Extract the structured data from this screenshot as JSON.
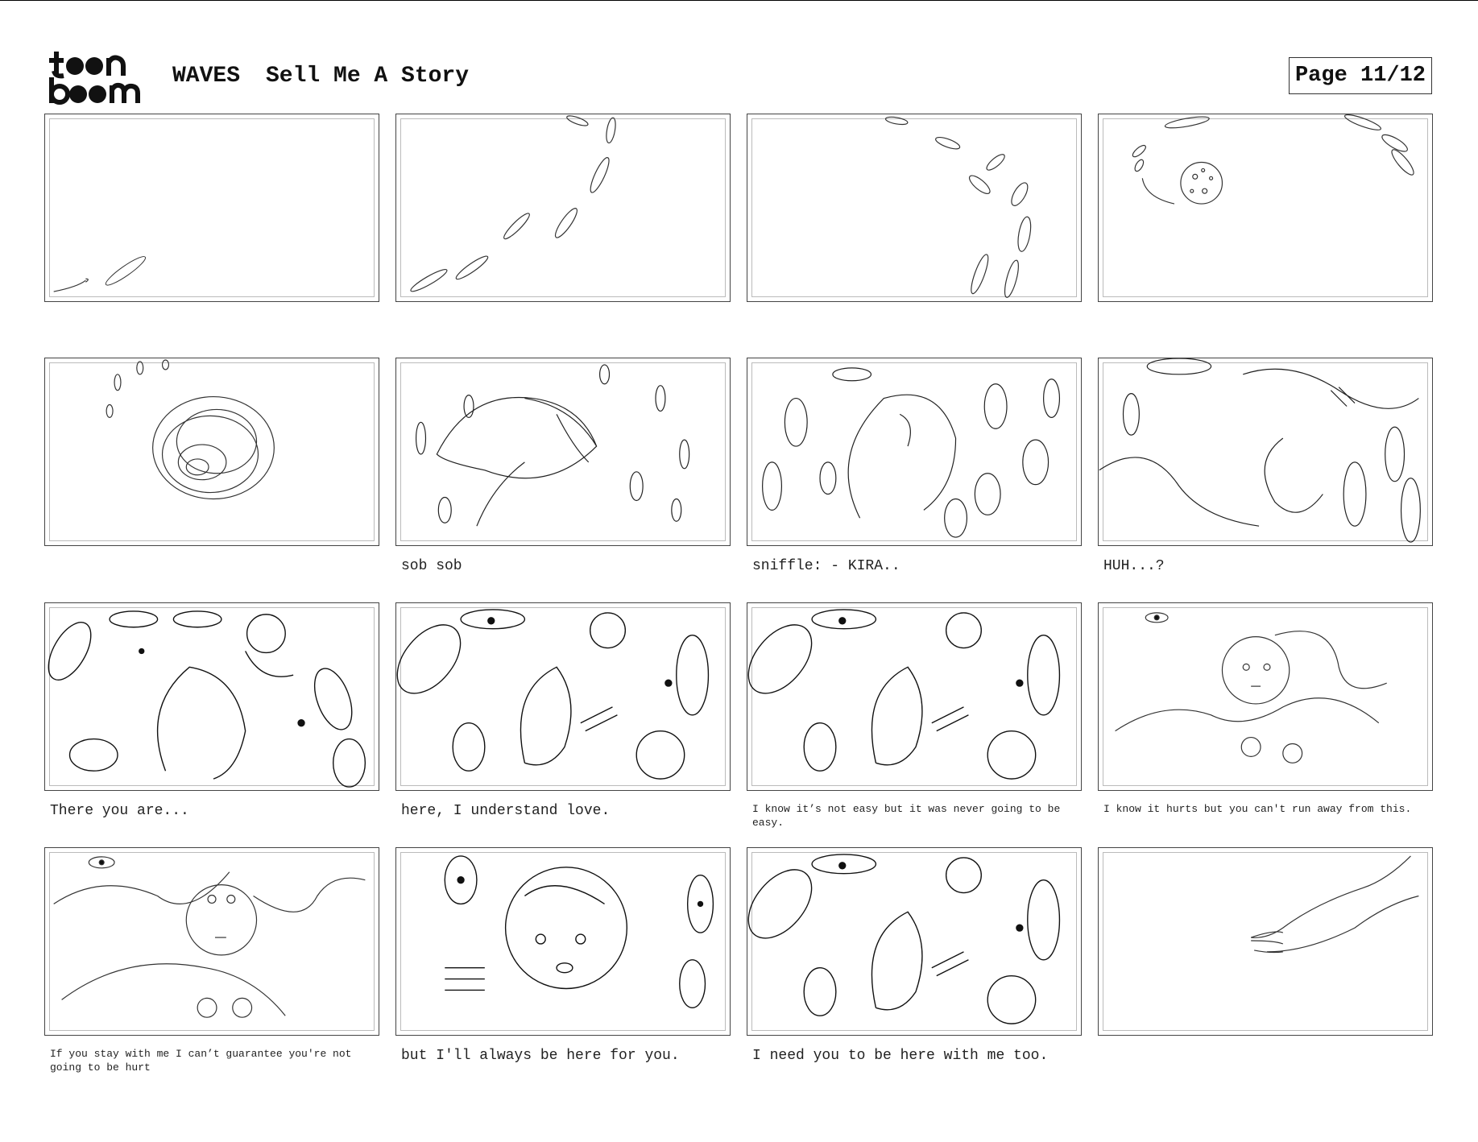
{
  "header": {
    "logo_text": "toonboom",
    "project": "WAVES",
    "section": "Sell Me A Story",
    "page": "Page 11/12"
  },
  "panels": [
    {
      "caption": ""
    },
    {
      "caption": ""
    },
    {
      "caption": ""
    },
    {
      "caption": ""
    },
    {
      "caption": ""
    },
    {
      "caption": "sob sob"
    },
    {
      "caption": "sniffle: - KIRA.."
    },
    {
      "caption": "HUH...?"
    },
    {
      "caption": "There you are..."
    },
    {
      "caption": "here, I understand love."
    },
    {
      "caption": "I know it’s not easy but it was never going to be easy."
    },
    {
      "caption": "I know it hurts but you can't run away from this."
    },
    {
      "caption": "If you stay with me I can’t guarantee you're not going to be hurt"
    },
    {
      "caption": "but I'll always be here for you."
    },
    {
      "caption": "I need you to be here with me too."
    },
    {
      "caption": ""
    }
  ]
}
